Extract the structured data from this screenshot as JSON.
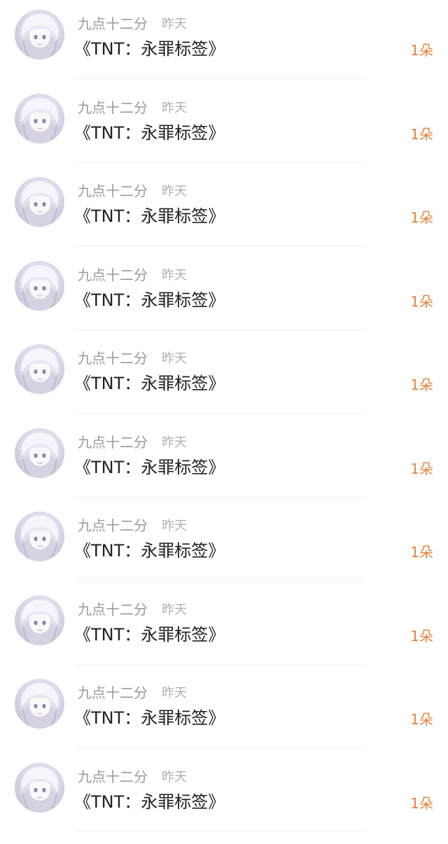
{
  "feed": {
    "items": [
      {
        "user": "九点十二分",
        "time": "昨天",
        "title": "《TNT：永罪标签》",
        "gift": "1朵"
      },
      {
        "user": "九点十二分",
        "time": "昨天",
        "title": "《TNT：永罪标签》",
        "gift": "1朵"
      },
      {
        "user": "九点十二分",
        "time": "昨天",
        "title": "《TNT：永罪标签》",
        "gift": "1朵"
      },
      {
        "user": "九点十二分",
        "time": "昨天",
        "title": "《TNT：永罪标签》",
        "gift": "1朵"
      },
      {
        "user": "九点十二分",
        "time": "昨天",
        "title": "《TNT：永罪标签》",
        "gift": "1朵"
      },
      {
        "user": "九点十二分",
        "time": "昨天",
        "title": "《TNT：永罪标签》",
        "gift": "1朵"
      },
      {
        "user": "九点十二分",
        "time": "昨天",
        "title": "《TNT：永罪标签》",
        "gift": "1朵"
      },
      {
        "user": "九点十二分",
        "time": "昨天",
        "title": "《TNT：永罪标签》",
        "gift": "1朵"
      },
      {
        "user": "九点十二分",
        "time": "昨天",
        "title": "《TNT：永罪标签》",
        "gift": "1朵"
      },
      {
        "user": "九点十二分",
        "time": "昨天",
        "title": "《TNT：永罪标签》",
        "gift": "1朵"
      }
    ]
  },
  "colors": {
    "username": "#9a9a9a",
    "timestamp": "#b0b0b0",
    "title": "#222222",
    "gift_accent": "#e8833a"
  },
  "icons": {
    "avatar": "anime-avatar-image"
  }
}
